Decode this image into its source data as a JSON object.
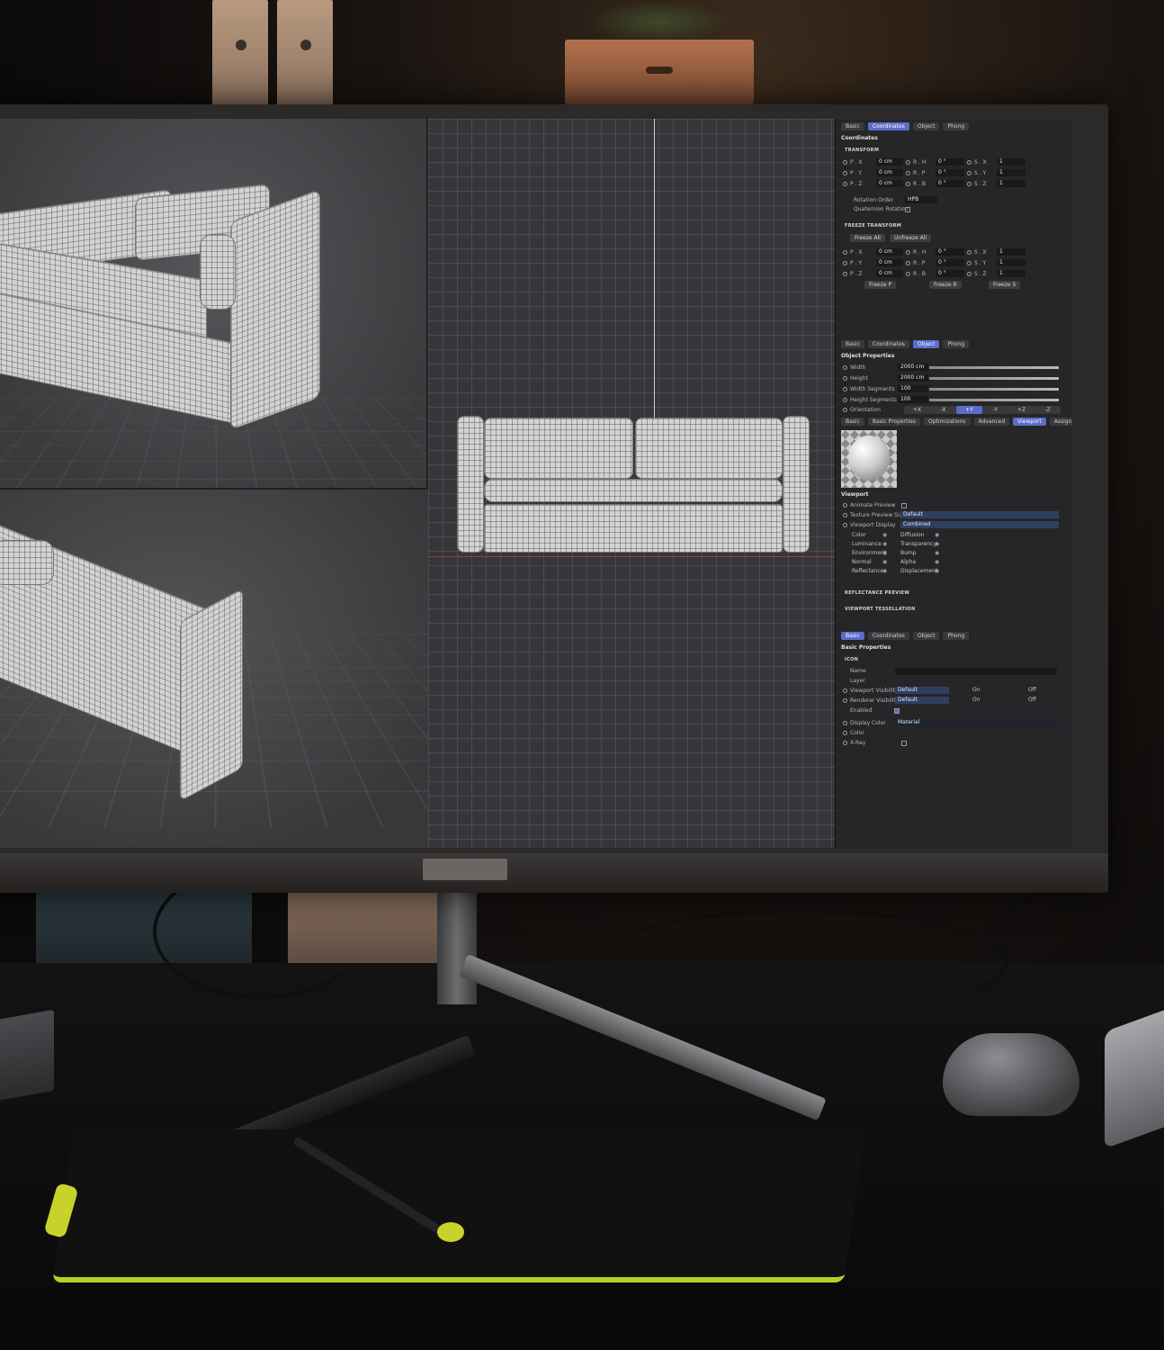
{
  "panel1": {
    "tabs": [
      "Basic",
      "Coordinates",
      "Object",
      "Phong"
    ],
    "title": "Coordinates",
    "transform": "TRANSFORM",
    "rows": [
      [
        "P . X",
        "0 cm",
        "R . H",
        "0 °",
        "S . X",
        "1"
      ],
      [
        "P . Y",
        "0 cm",
        "R . P",
        "0 °",
        "S . Y",
        "1"
      ],
      [
        "P . Z",
        "0 cm",
        "R . B",
        "0 °",
        "S . Z",
        "1"
      ]
    ],
    "rotation_order_label": "Rotation Order",
    "rotation_order_value": "HPB",
    "quaternion_label": "Quaternion Rotation",
    "freeze_section": "FREEZE TRANSFORM",
    "freeze_all": "Freeze All",
    "unfreeze_all": "Unfreeze All",
    "freeze_rows": [
      [
        "P . X",
        "0 cm",
        "R . H",
        "0 °",
        "S . X",
        "1"
      ],
      [
        "P . Y",
        "0 cm",
        "R . P",
        "0 °",
        "S . Y",
        "1"
      ],
      [
        "P . Z",
        "0 cm",
        "R . B",
        "0 °",
        "S . Z",
        "1"
      ]
    ],
    "freeze_p": "Freeze P",
    "freeze_r": "Freeze R",
    "freeze_s": "Freeze S"
  },
  "panel2": {
    "tabs": [
      "Basic",
      "Coordinates",
      "Object",
      "Phong"
    ],
    "title": "Object Properties",
    "props": [
      {
        "label": "Width",
        "value": "2000 cm"
      },
      {
        "label": "Height",
        "value": "2000 cm"
      },
      {
        "label": "Width Segments",
        "value": "100"
      },
      {
        "label": "Height Segments",
        "value": "100"
      },
      {
        "label": "Orientation",
        "value": ""
      }
    ],
    "orientation": [
      "+X",
      "-X",
      "+Y",
      "-Y",
      "+Z",
      "-Z"
    ]
  },
  "panel3": {
    "tabs": [
      "Basic",
      "Basic Properties",
      "Optimizations",
      "Advanced",
      "Viewport",
      "Assign"
    ],
    "title": "Viewport",
    "props": [
      "Animate Preview",
      "Texture Preview Size",
      "Viewport Display"
    ],
    "texture_preview_size": "Default",
    "viewport_display": "Combined",
    "channels_left": [
      "Color",
      "Luminance",
      "Environment",
      "Normal",
      "Reflectance"
    ],
    "channels_right": [
      "Diffusion",
      "Transparency",
      "Bump",
      "Alpha",
      "Displacement"
    ],
    "reflectance_preview": "REFLECTANCE PREVIEW",
    "viewport_tessellation": "VIEWPORT TESSELLATION"
  },
  "panel4": {
    "tabs": [
      "Basic",
      "Coordinates",
      "Object",
      "Phong"
    ],
    "title": "Basic Properties",
    "icon_section": "ICON",
    "name_label": "Name",
    "layer_label": "Layer",
    "visible_editor": "Viewport Visibility",
    "visible_renderer": "Renderer Visibility",
    "vis_options": [
      "Default",
      "On",
      "Off"
    ],
    "enabled_label": "Enabled",
    "display_color_label": "Display Color",
    "display_color_value": "Material",
    "color_label": "Color",
    "xray_label": "X-Ray"
  },
  "colors": {
    "accent": "#5b6cc9",
    "panel_bg": "#262628",
    "viewport_bg": "#36363a",
    "tablet_accent": "#b9cf27"
  }
}
